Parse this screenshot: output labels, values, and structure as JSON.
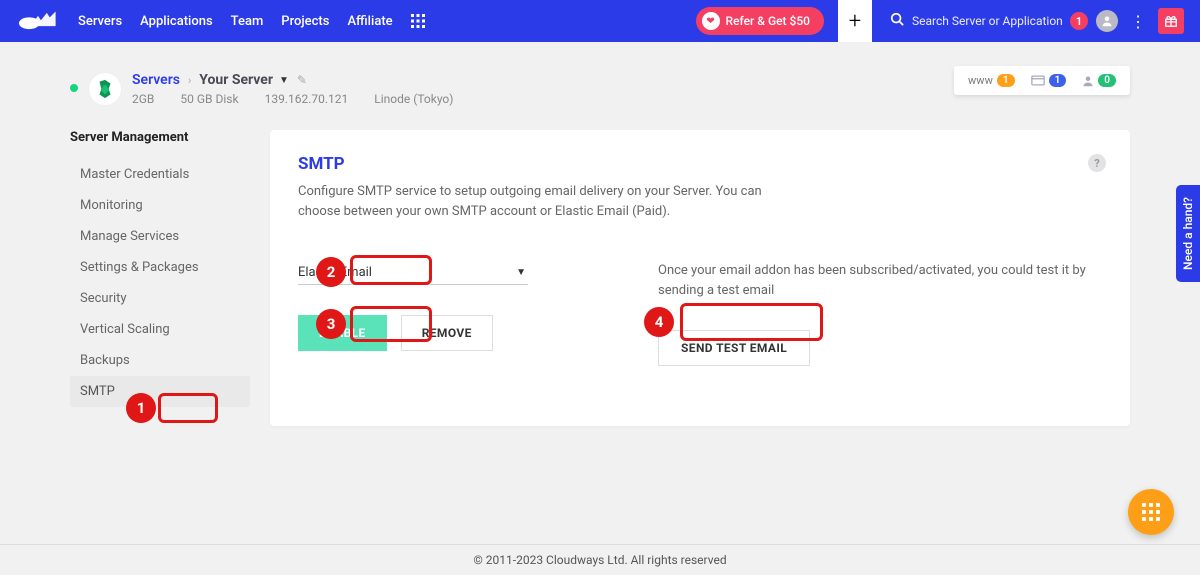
{
  "nav": {
    "links": [
      "Servers",
      "Applications",
      "Team",
      "Projects",
      "Affiliate"
    ],
    "refer": "Refer & Get $50",
    "search_placeholder": "Search Server or Application",
    "notif_count": "1"
  },
  "server": {
    "crumb_root": "Servers",
    "name": "Your Server",
    "ram": "2GB",
    "disk": "50 GB Disk",
    "ip": "139.162.70.121",
    "region": "Linode (Tokyo)"
  },
  "status": {
    "www_label": "www",
    "www_count": "1",
    "card_count": "1",
    "user_count": "0"
  },
  "sidebar": {
    "heading": "Server Management",
    "items": [
      "Master Credentials",
      "Monitoring",
      "Manage Services",
      "Settings & Packages",
      "Security",
      "Vertical Scaling",
      "Backups",
      "SMTP"
    ],
    "active_index": 7
  },
  "smtp": {
    "title": "SMTP",
    "description": "Configure SMTP service to setup outgoing email delivery on your Server. You can choose between your own SMTP account or Elastic Email (Paid).",
    "select_value": "Elastic Email",
    "enable_label": "ENABLE",
    "remove_label": "REMOVE",
    "test_note": "Once your email addon has been subscribed/activated, you could test it by sending a test email",
    "send_test": "SEND TEST EMAIL"
  },
  "callouts": {
    "c1": "1",
    "c2": "2",
    "c3": "3",
    "c4": "4"
  },
  "footer": "© 2011-2023 Cloudways Ltd. All rights reserved",
  "need_hand": "Need a hand?"
}
